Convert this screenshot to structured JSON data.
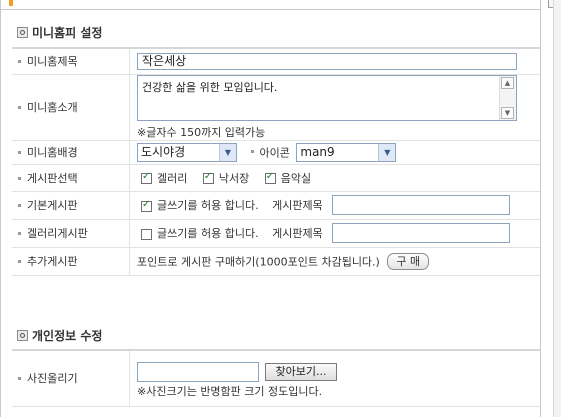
{
  "section1": {
    "title": "미니홈피 설정"
  },
  "rows": {
    "title": {
      "label": "미니홈제목",
      "value": "작은세상"
    },
    "intro": {
      "label": "미니홈소개",
      "value": "건강한 삶을 위한 모임입니다.",
      "note": "※글자수 150까지 입력가능"
    },
    "background": {
      "label": "미니홈배경",
      "value": "도시야경",
      "icon_label": "아이콘",
      "icon_value": "man9"
    },
    "boards": {
      "label": "게시판선택",
      "options": [
        {
          "label": "겔러리",
          "checked": true
        },
        {
          "label": "낙서장",
          "checked": true
        },
        {
          "label": "음악실",
          "checked": true
        }
      ]
    },
    "basic_board": {
      "label": "기본게시판",
      "write_label": "글쓰기를 허용 합니다.",
      "write_checked": true,
      "title_label": "게시판제목",
      "title_value": ""
    },
    "gallery_board": {
      "label": "겔러리게시판",
      "write_label": "글쓰기를 허용 합니다.",
      "write_checked": false,
      "title_label": "게시판제목",
      "title_value": ""
    },
    "extra_board": {
      "label": "추가게시판",
      "text": "포인트로 게시판 구매하기(1000포인트 차감됩니다.)",
      "button": "구 매"
    }
  },
  "section2": {
    "title": "개인정보 수정"
  },
  "photo": {
    "label": "사진올리기",
    "button": "찾아보기...",
    "note": "※사진크기는 반명함판 크기 정도입니다."
  }
}
